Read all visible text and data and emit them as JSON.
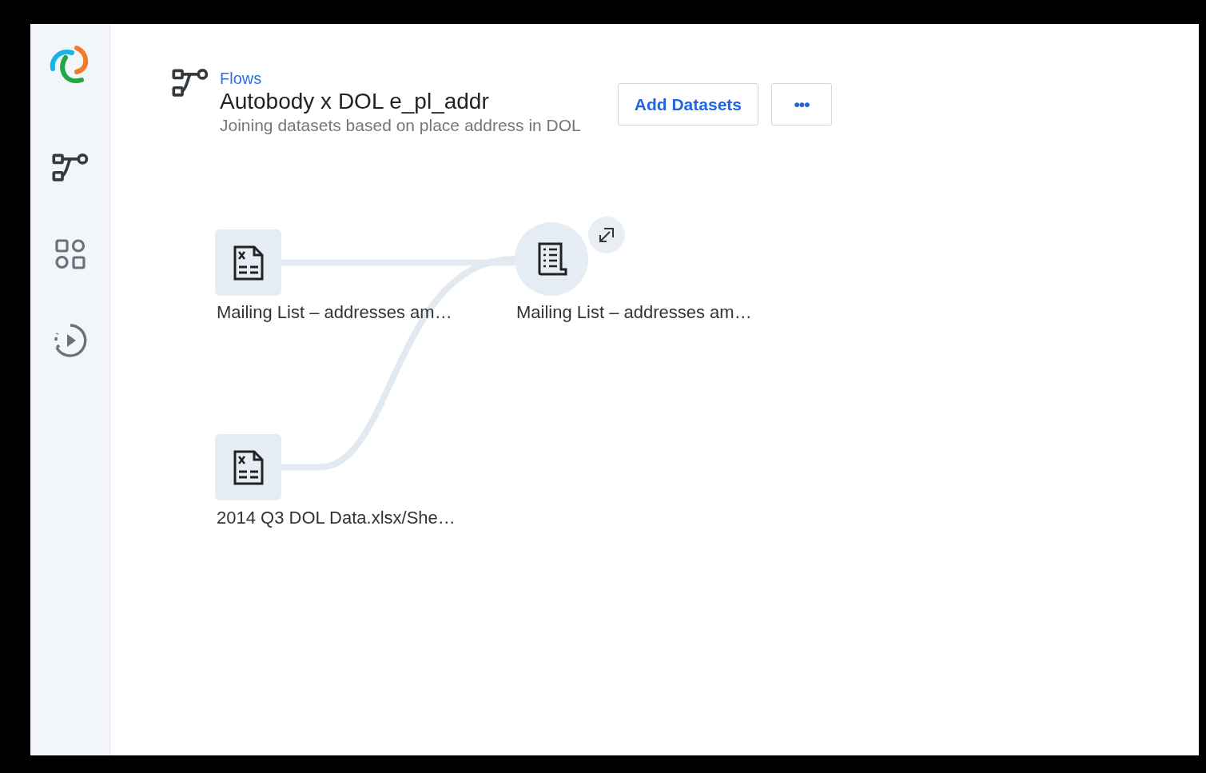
{
  "sidebar": {
    "items": [
      {
        "kind": "flows"
      },
      {
        "kind": "datasets"
      },
      {
        "kind": "runs"
      }
    ]
  },
  "header": {
    "breadcrumb": "Flows",
    "title": "Autobody x DOL e_pl_addr",
    "description": "Joining datasets based on place address in DOL",
    "buttons": [
      {
        "kind": "text",
        "label": "Add Datasets"
      },
      {
        "kind": "more",
        "label": "•••"
      }
    ]
  },
  "canvas": {
    "nodes": [
      {
        "kind": "source",
        "label": "Mailing List – addresses am…"
      },
      {
        "kind": "output",
        "label": "Mailing List – addresses am…"
      },
      {
        "kind": "source",
        "label": "2014 Q3 DOL Data.xlsx/She…"
      }
    ]
  }
}
